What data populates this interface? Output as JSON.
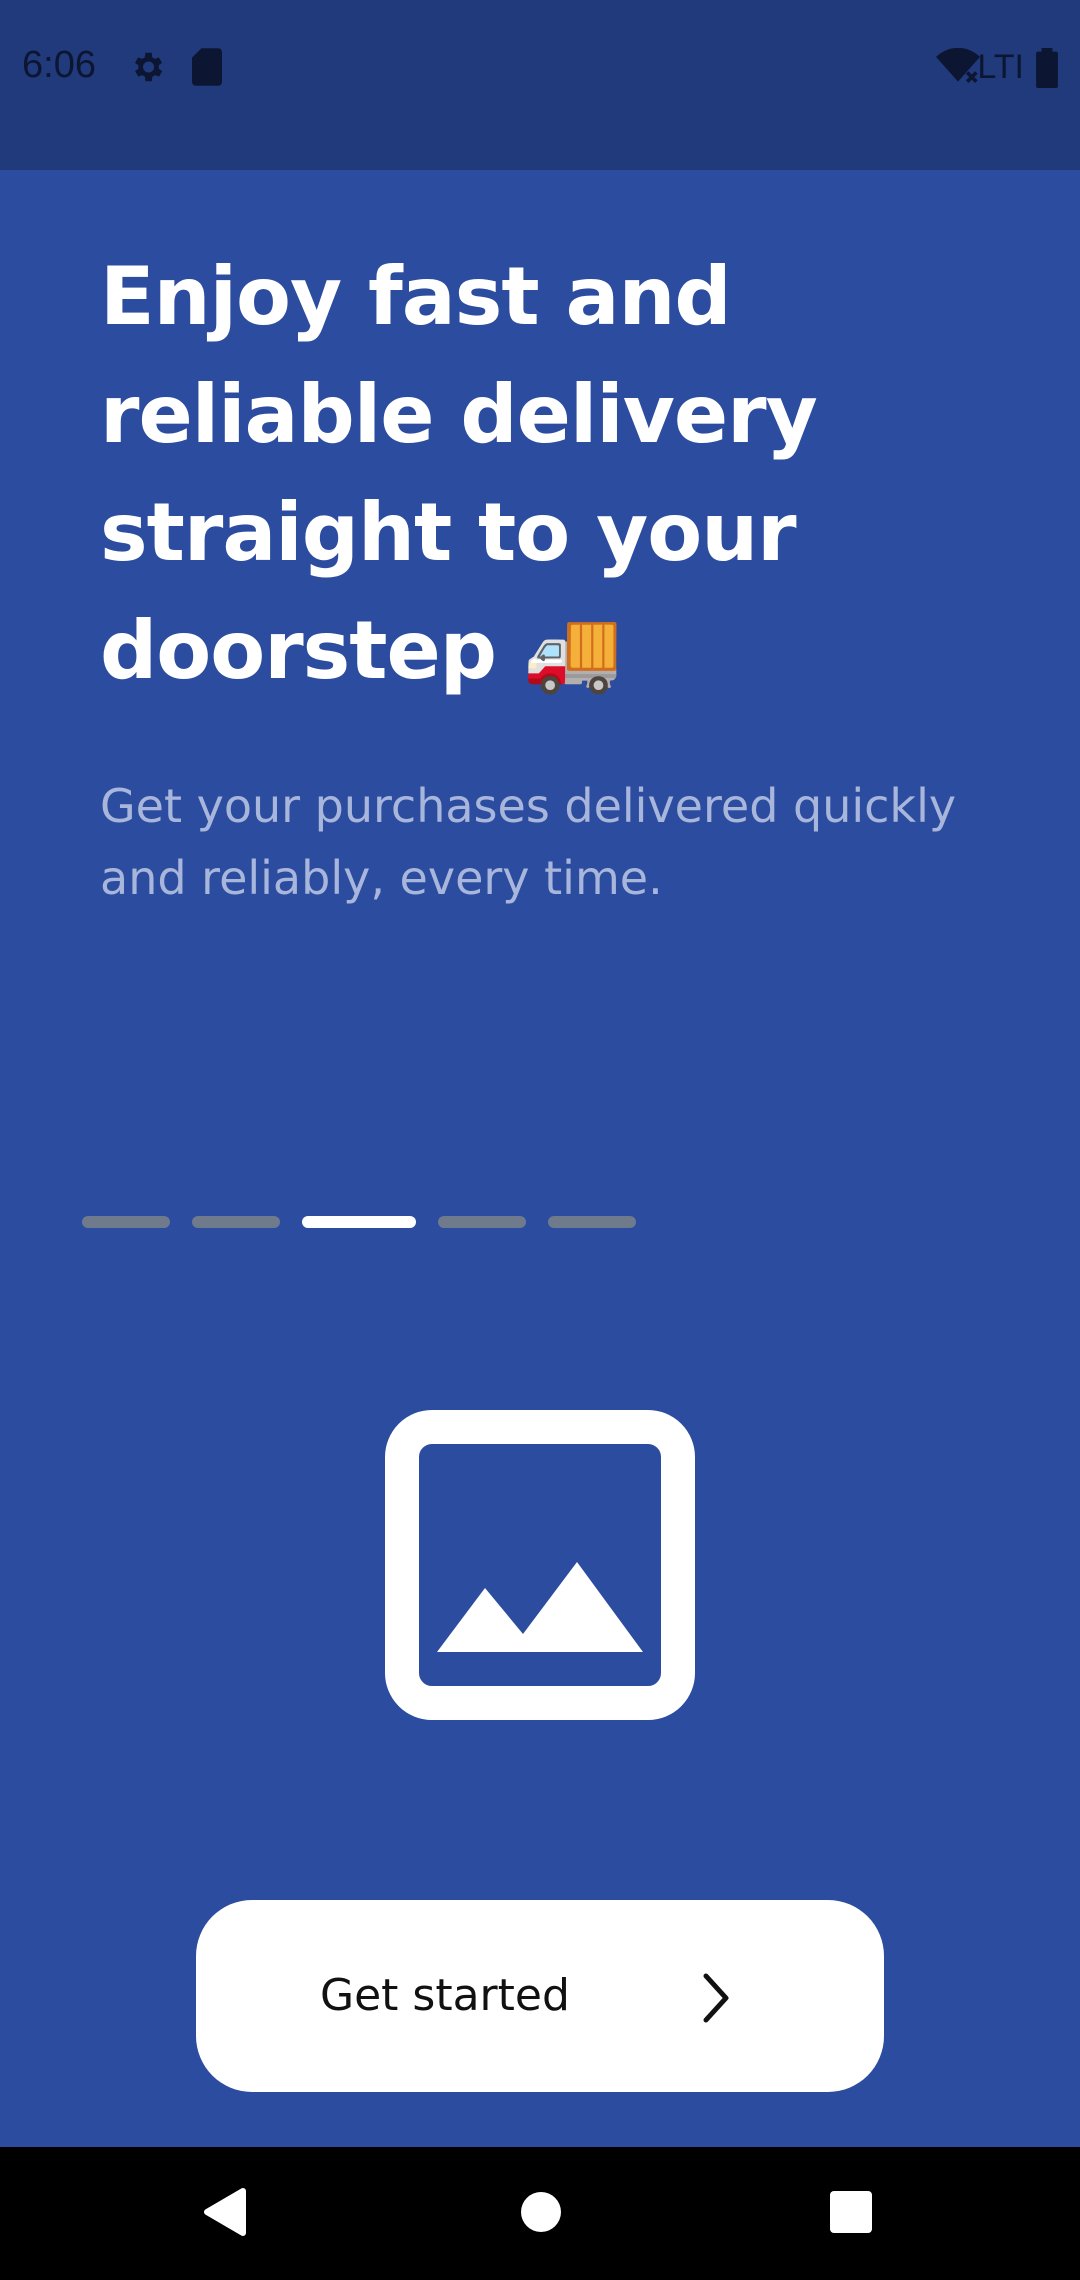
{
  "status_bar": {
    "time": "6:06",
    "network_label": "LTI",
    "icons": [
      "gear-icon",
      "sd-card-icon",
      "wifi-off-icon",
      "battery-icon"
    ]
  },
  "onboarding": {
    "headline": "Enjoy fast and reliable delivery straight to your doorstep 🚚",
    "subtitle": "Get your purchases delivered quickly and reliably, every time.",
    "pager": {
      "total": 5,
      "active_index": 2
    },
    "image_icon": "image-placeholder-icon",
    "cta_label": "Get started",
    "cta_icon": "chevron-right-icon"
  },
  "nav_bar": {
    "buttons": [
      "back-icon",
      "home-icon",
      "recents-icon"
    ]
  },
  "colors": {
    "background": "#2c4d9f",
    "status_bar": "#213a7b",
    "text_primary": "#ffffff",
    "text_secondary": "#a9b6dc",
    "pager_inactive": "#6f7a8c",
    "button_bg": "#ffffff"
  }
}
